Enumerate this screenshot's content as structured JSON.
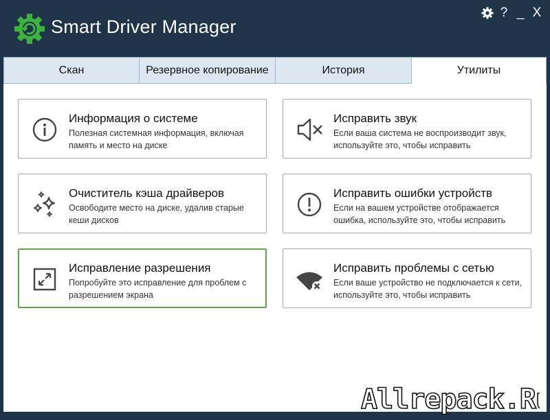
{
  "app": {
    "title": "Smart Driver Manager"
  },
  "window_controls": {
    "settings_icon": "gear-icon",
    "help_label": "?",
    "minimize_label": "_",
    "close_label": "X"
  },
  "tabs": [
    {
      "label": "Скан",
      "active": false
    },
    {
      "label": "Резервное копирование",
      "active": false
    },
    {
      "label": "История",
      "active": false
    },
    {
      "label": "Утилиты",
      "active": true
    }
  ],
  "cards": [
    {
      "icon": "info-icon",
      "title": "Информация о системе",
      "desc": "Полезная системная информация, включая память и место на диске"
    },
    {
      "icon": "speaker-mute-icon",
      "title": "Исправить звук",
      "desc": "Если ваша система не воспроизводит звук, используйте это, чтобы исправить"
    },
    {
      "icon": "sparkle-icon",
      "title": "Очиститель кэша драйверов",
      "desc": "Освободите место на диске, удалив старые кеши дисков"
    },
    {
      "icon": "alert-circle-icon",
      "title": "Исправить ошибки устройств",
      "desc": "Если на вашем устройстве отображается ошибка, используйте это, чтобы исправить"
    },
    {
      "icon": "resize-icon",
      "title": "Исправление разрешения",
      "desc": "Попробуйте это исправление для проблем с разрешением экрана",
      "selected": true
    },
    {
      "icon": "wifi-off-icon",
      "title": "Исправить проблемы с сетью",
      "desc": "Если ваше устройство не подключается к сети, используйте это, чтобы исправить"
    }
  ],
  "watermark": {
    "text": "Allrepack.Ru"
  },
  "colors": {
    "titlebar_bg": "#1f3449",
    "logo_green": "#3db33d",
    "tab_inactive_bg": "#dde7f1",
    "selected_border": "#5aa84a"
  }
}
